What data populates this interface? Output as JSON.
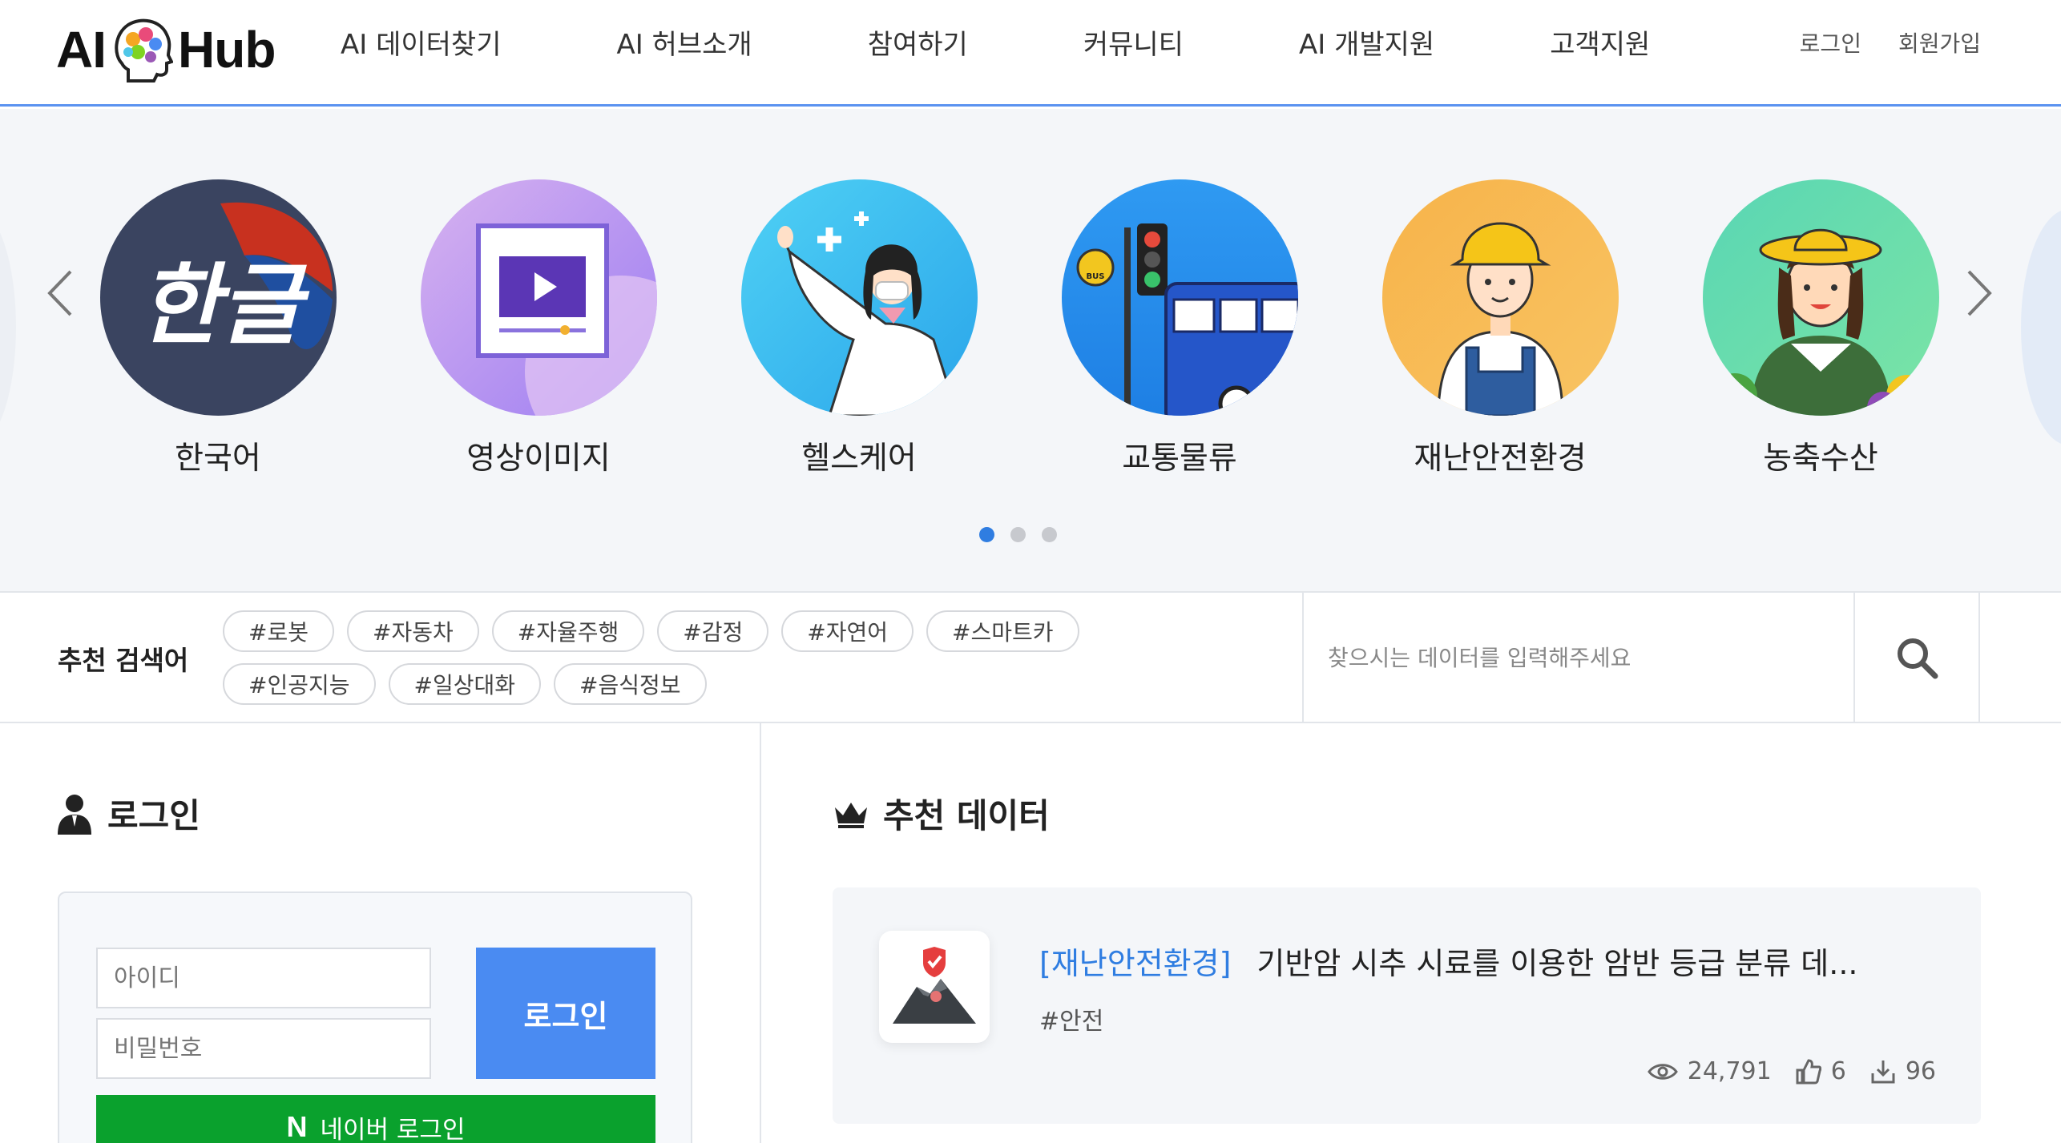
{
  "header": {
    "logo": {
      "left": "AI",
      "right": "Hub"
    },
    "nav": [
      "AI 데이터찾기",
      "AI 허브소개",
      "참여하기",
      "커뮤니티",
      "AI 개발지원",
      "고객지원"
    ],
    "login": "로그인",
    "signup": "회원가입"
  },
  "carousel": {
    "items": [
      {
        "label": "한국어",
        "icon": "hangul-illustration"
      },
      {
        "label": "영상이미지",
        "icon": "video-player-illustration"
      },
      {
        "label": "헬스케어",
        "icon": "doctor-illustration"
      },
      {
        "label": "교통물류",
        "icon": "bus-traffic-light-illustration"
      },
      {
        "label": "재난안전환경",
        "icon": "worker-illustration"
      },
      {
        "label": "농축수산",
        "icon": "farmer-illustration"
      }
    ],
    "hangul_text": "한글",
    "bus_text": "BUS",
    "pages": 3,
    "active_page": 1
  },
  "keywords": {
    "title": "추천 검색어",
    "tags": [
      "#로봇",
      "#자동차",
      "#자율주행",
      "#감정",
      "#자연어",
      "#스마트카",
      "#인공지능",
      "#일상대화",
      "#음식정보"
    ]
  },
  "search": {
    "placeholder": "찾으시는 데이터를 입력해주세요"
  },
  "login": {
    "title": "로그인",
    "id_placeholder": "아이디",
    "pw_placeholder": "비밀번호",
    "button": "로그인",
    "naver_logo": "N",
    "naver_button": "네이버 로그인"
  },
  "recommended": {
    "title": "추천 데이터",
    "item": {
      "category": "[재난안전환경]",
      "name": "기반암 시추 시료를 이용한 암반 등급 분류 데...",
      "tag": "#안전",
      "views": "24,791",
      "likes": "6",
      "downloads": "96"
    }
  },
  "colors": {
    "accent": "#2f7de1",
    "login_button": "#4a8bf2",
    "naver_green": "#0aa12d",
    "header_border": "#5b93f0"
  }
}
